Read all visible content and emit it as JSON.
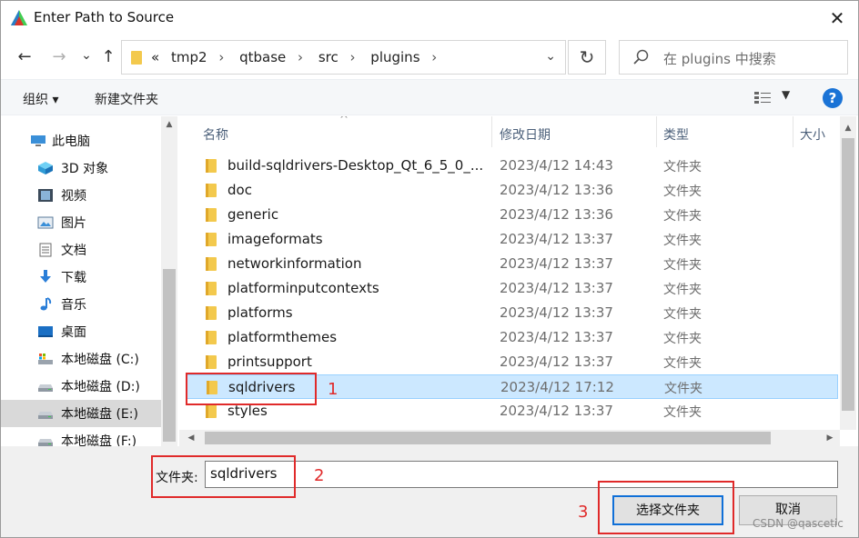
{
  "window": {
    "title": "Enter Path to Source",
    "close_glyph": "✕"
  },
  "nav": {
    "back_glyph": "←",
    "forward_glyph": "→",
    "recent_glyph": "⌄",
    "up_glyph": "↑",
    "address": {
      "overflow": "«",
      "crumbs": [
        "tmp2",
        "qtbase",
        "src",
        "plugins"
      ],
      "separator": "›",
      "dropdown_glyph": "⌄"
    },
    "refresh_glyph": "↻",
    "search_placeholder": "在 plugins 中搜索"
  },
  "toolbar": {
    "organize_label": "组织 ▾",
    "new_folder_label": "新建文件夹",
    "help_label": "?"
  },
  "sidebar": {
    "items": [
      {
        "label": "此电脑",
        "icon": "pc-icon"
      },
      {
        "label": "3D 对象",
        "icon": "3d-objects-icon"
      },
      {
        "label": "视频",
        "icon": "video-icon"
      },
      {
        "label": "图片",
        "icon": "pictures-icon"
      },
      {
        "label": "文档",
        "icon": "documents-icon"
      },
      {
        "label": "下载",
        "icon": "download-icon"
      },
      {
        "label": "音乐",
        "icon": "music-icon"
      },
      {
        "label": "桌面",
        "icon": "desktop-icon"
      },
      {
        "label": "本地磁盘 (C:)",
        "icon": "drive-c-icon"
      },
      {
        "label": "本地磁盘 (D:)",
        "icon": "drive-icon"
      },
      {
        "label": "本地磁盘 (E:)",
        "icon": "drive-icon",
        "selected": true
      },
      {
        "label": "本地磁盘 (F:)",
        "icon": "drive-icon"
      }
    ]
  },
  "file_list": {
    "columns": [
      "名称",
      "修改日期",
      "类型",
      "大小"
    ],
    "rows": [
      {
        "name": "build-sqldrivers-Desktop_Qt_6_5_0_...",
        "date": "2023/4/12 14:43",
        "type": "文件夹"
      },
      {
        "name": "doc",
        "date": "2023/4/12 13:36",
        "type": "文件夹"
      },
      {
        "name": "generic",
        "date": "2023/4/12 13:36",
        "type": "文件夹"
      },
      {
        "name": "imageformats",
        "date": "2023/4/12 13:37",
        "type": "文件夹"
      },
      {
        "name": "networkinformation",
        "date": "2023/4/12 13:37",
        "type": "文件夹"
      },
      {
        "name": "platforminputcontexts",
        "date": "2023/4/12 13:37",
        "type": "文件夹"
      },
      {
        "name": "platforms",
        "date": "2023/4/12 13:37",
        "type": "文件夹"
      },
      {
        "name": "platformthemes",
        "date": "2023/4/12 13:37",
        "type": "文件夹"
      },
      {
        "name": "printsupport",
        "date": "2023/4/12 13:37",
        "type": "文件夹"
      },
      {
        "name": "sqldrivers",
        "date": "2023/4/12 17:12",
        "type": "文件夹",
        "selected": true
      },
      {
        "name": "styles",
        "date": "2023/4/12 13:37",
        "type": "文件夹"
      }
    ]
  },
  "footer": {
    "folder_label": "文件夹:",
    "folder_value": "sqldrivers",
    "select_button": "选择文件夹",
    "cancel_button": "取消",
    "watermark": "CSDN @qascetic"
  },
  "annotations": [
    "1",
    "2",
    "3"
  ],
  "colors": {
    "accent": "#1070d8",
    "selection": "#cce8ff",
    "annotation": "#e02a2a",
    "folder": "#f3c94d"
  }
}
